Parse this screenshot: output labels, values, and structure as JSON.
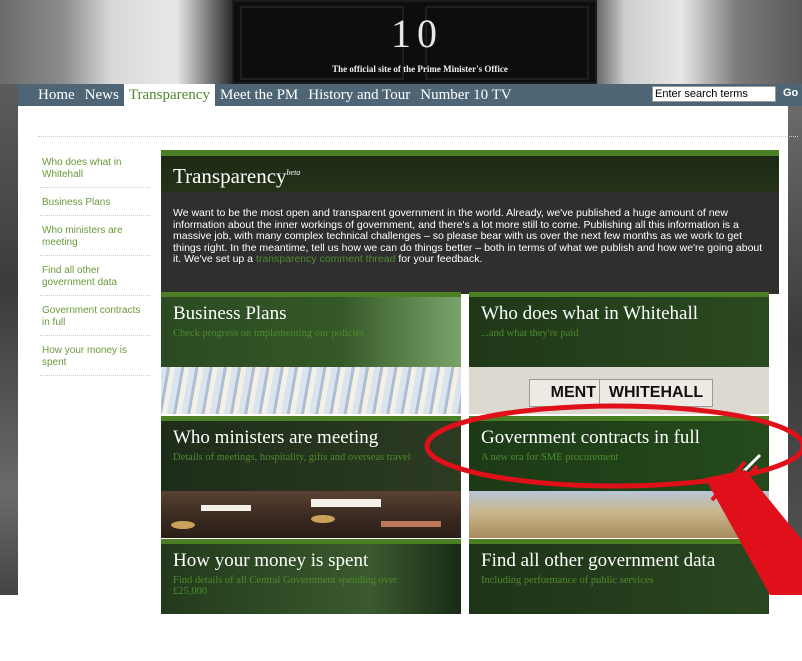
{
  "header": {
    "number": "10",
    "tagline": "The official site of the Prime Minister's Office"
  },
  "nav": {
    "items": [
      "Home",
      "News",
      "Transparency",
      "Meet the PM",
      "History and Tour",
      "Number 10 TV"
    ],
    "active": "Transparency",
    "search": {
      "value": "Enter search terms",
      "go": "Go"
    }
  },
  "sidebar": {
    "items": [
      "Who does what in Whitehall",
      "Business Plans",
      "Who ministers are meeting",
      "Find all other government data",
      "Government contracts in full",
      "How your money is spent"
    ]
  },
  "intro": {
    "title": "Transparency",
    "badge": "beta",
    "text_before": "We want to be the most open and transparent government in the world. Already, we've published a huge amount of new information about the inner workings of government, and there's a lot more still to come. Publishing all this information is a massive job, with many complex technical challenges – so please bear with us over the next few months as we work to get things right. In the meantime, tell us how we can do things better – both in terms of what we publish and how we're going about it. We've set up a",
    "link": "transparency comment thread",
    "text_after": "for your feedback."
  },
  "tiles": [
    {
      "title": "Business Plans",
      "subtitle": "Check progress on implementing our policies"
    },
    {
      "title": "Who does what in Whitehall",
      "subtitle": "...and what they're paid",
      "sign_left": "MENT",
      "sign_right": "WHITEHALL"
    },
    {
      "title": "Who ministers are meeting",
      "subtitle": "Details of meetings, hospitality, gifts and overseas travel"
    },
    {
      "title": "Government contracts in full",
      "subtitle": "A new era for SME procurement"
    },
    {
      "title": "How your money is spent",
      "subtitle": "Find details of all Central Government spending over £25,000"
    },
    {
      "title": "Find all other government data",
      "subtitle": "Including performance of public services"
    }
  ],
  "colors": {
    "nav_bg": "#4d6575",
    "accent_green": "#4f8a2e",
    "annotation_red": "#e0101a"
  }
}
